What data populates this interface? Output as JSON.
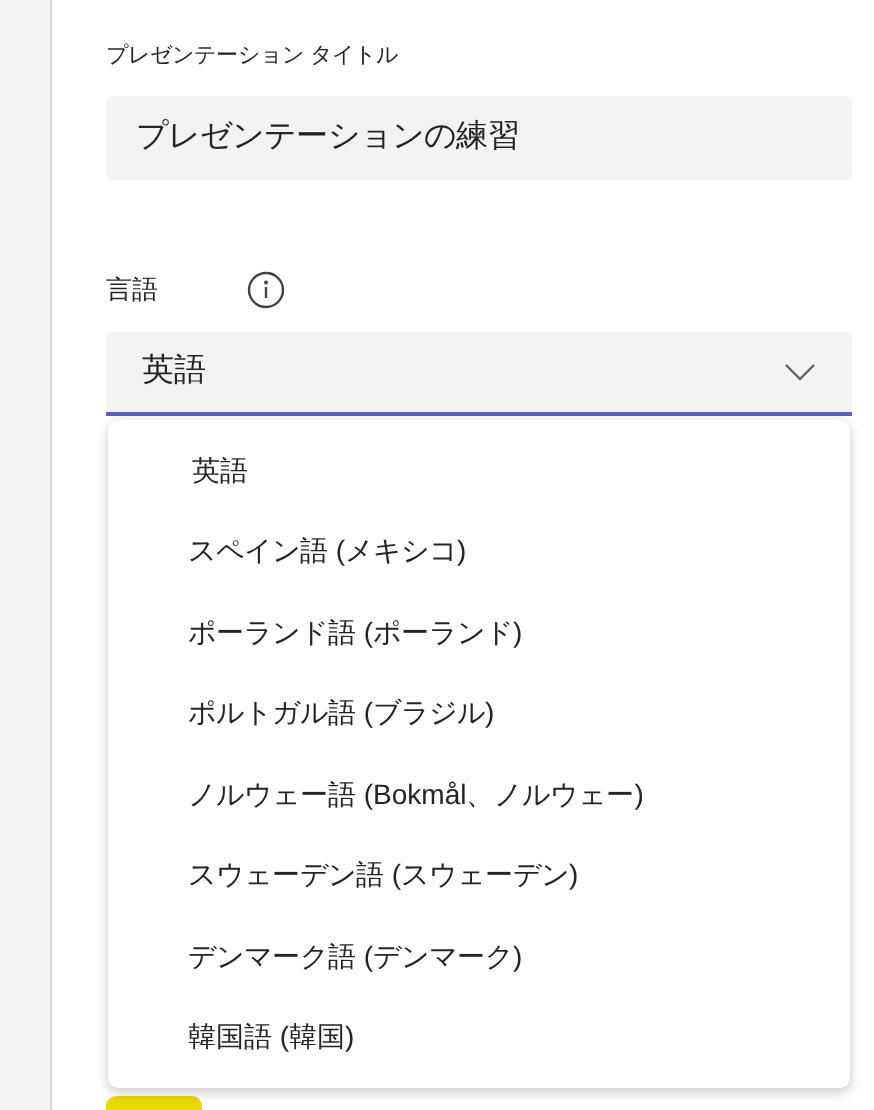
{
  "title_field": {
    "label": "プレゼンテーション タイトル",
    "value": "プレゼンテーションの練習"
  },
  "language_field": {
    "label": "言語",
    "value": "英語",
    "expanded": true
  },
  "language_options": [
    {
      "label": "英語"
    },
    {
      "label": "スペイン語 (メキシコ)"
    },
    {
      "label": "ポーランド語 (ポーランド)"
    },
    {
      "label": "ポルトガル語 (ブラジル)"
    },
    {
      "label": "ノルウェー語 (Bokmål、ノルウェー)"
    },
    {
      "label": "スウェーデン語 (スウェーデン)"
    },
    {
      "label": "デンマーク語 (デンマーク)"
    },
    {
      "label": "韓国語 (韓国)"
    }
  ]
}
